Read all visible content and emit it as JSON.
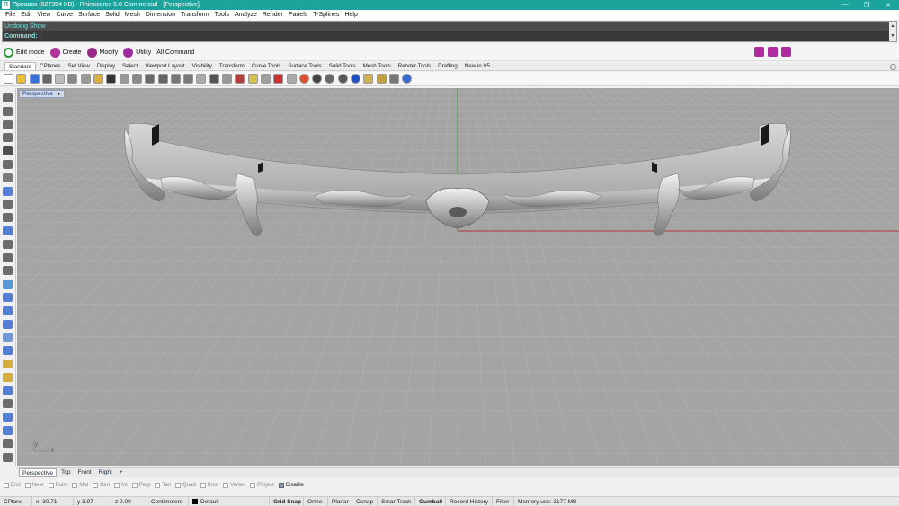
{
  "titlebar": {
    "title": "Приавок (827354 KB) - Rhinoceros 5.0 Commercial - [Perspective]"
  },
  "menu": [
    "File",
    "Edit",
    "View",
    "Curve",
    "Surface",
    "Solid",
    "Mesh",
    "Dimension",
    "Transform",
    "Tools",
    "Analyze",
    "Render",
    "Panels",
    "T-Splines",
    "Help"
  ],
  "command": {
    "history": "Undoing Show",
    "prompt": "Command:"
  },
  "toolbar": {
    "edit_mode": "Edit mode",
    "create": "Create",
    "modify": "Modify",
    "utility": "Utility",
    "all_command": "All Command"
  },
  "tabs": [
    "Standard",
    "CPlanes",
    "Set View",
    "Display",
    "Select",
    "Viewport Layout",
    "Visibility",
    "Transform",
    "Curve Tools",
    "Surface Tools",
    "Solid Tools",
    "Mesh Tools",
    "Render Tools",
    "Drafting",
    "New in V5"
  ],
  "viewport": {
    "label": "Perspective",
    "axis_y": "y",
    "axis_x": "x"
  },
  "view_tabs": [
    "Perspective",
    "Top",
    "Front",
    "Right",
    "+"
  ],
  "osnaps": [
    "End",
    "Near",
    "Point",
    "Mid",
    "Cen",
    "Int",
    "Perp",
    "Tan",
    "Quad",
    "Knot",
    "Vertex",
    "Project",
    "Disable"
  ],
  "status": {
    "cplane": "CPlane",
    "x": "x -30.71",
    "y": "y 3.97",
    "z": "z 0.00",
    "units": "Centimeters",
    "layer": "Default",
    "grid_snap": "Grid Snap",
    "ortho": "Ortho",
    "planar": "Planar",
    "osnap": "Osnap",
    "smarttrack": "SmartTrack",
    "gumball": "Gumball",
    "record_history": "Record History",
    "filter": "Filter",
    "memory": "Memory use: 3177 MB"
  },
  "colors": {
    "titlebar": "#1ba39c",
    "viewport_bg": "#a4a4a4",
    "grid_line": "#b1b1b1",
    "axis_x": "#b43a3a",
    "axis_y": "#2f9a3a"
  }
}
